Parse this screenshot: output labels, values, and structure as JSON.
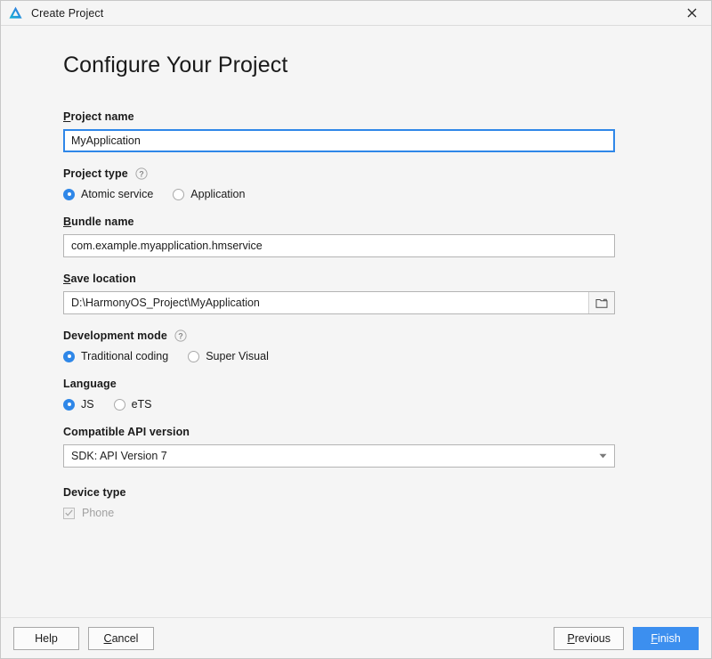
{
  "titlebar": {
    "title": "Create Project",
    "logo_icon": "deveco-logo-icon",
    "close_icon": "close-icon"
  },
  "page": {
    "heading": "Configure Your Project"
  },
  "fields": {
    "project_name": {
      "label": "Project name",
      "mnemonic": "P",
      "label_rest": "roject name",
      "value": "MyApplication",
      "focused": true
    },
    "project_type": {
      "label": "Project type",
      "help_icon": "help-circle-icon",
      "options": [
        {
          "label": "Atomic service",
          "selected": true
        },
        {
          "label": "Application",
          "selected": false
        }
      ]
    },
    "bundle_name": {
      "label": "Bundle name",
      "mnemonic": "B",
      "label_rest": "undle name",
      "value": "com.example.myapplication.hmservice"
    },
    "save_location": {
      "label": "Save location",
      "mnemonic": "S",
      "label_rest": "ave location",
      "value": "D:\\HarmonyOS_Project\\MyApplication",
      "browse_icon": "folder-icon"
    },
    "development_mode": {
      "label": "Development mode",
      "help_icon": "help-circle-icon",
      "options": [
        {
          "label": "Traditional coding",
          "selected": true
        },
        {
          "label": "Super Visual",
          "selected": false
        }
      ]
    },
    "language": {
      "label": "Language",
      "options": [
        {
          "label": "JS",
          "selected": true
        },
        {
          "label": "eTS",
          "selected": false
        }
      ]
    },
    "api_version": {
      "label": "Compatible API version",
      "value": "SDK: API Version 7",
      "arrow_icon": "chevron-down-icon"
    },
    "device_type": {
      "label": "Device type",
      "options": [
        {
          "label": "Phone",
          "checked": true,
          "disabled": true
        }
      ]
    }
  },
  "footer": {
    "help": "Help",
    "cancel_mnemonic": "C",
    "cancel_rest": "ancel",
    "cancel": "Cancel",
    "previous_mnemonic": "P",
    "previous_rest": "revious",
    "previous": "Previous",
    "finish_mnemonic": "F",
    "finish_rest": "inish",
    "finish": "Finish"
  },
  "colors": {
    "accent": "#2f87e8",
    "primary_button": "#3c8fef",
    "background": "#f5f5f5"
  }
}
